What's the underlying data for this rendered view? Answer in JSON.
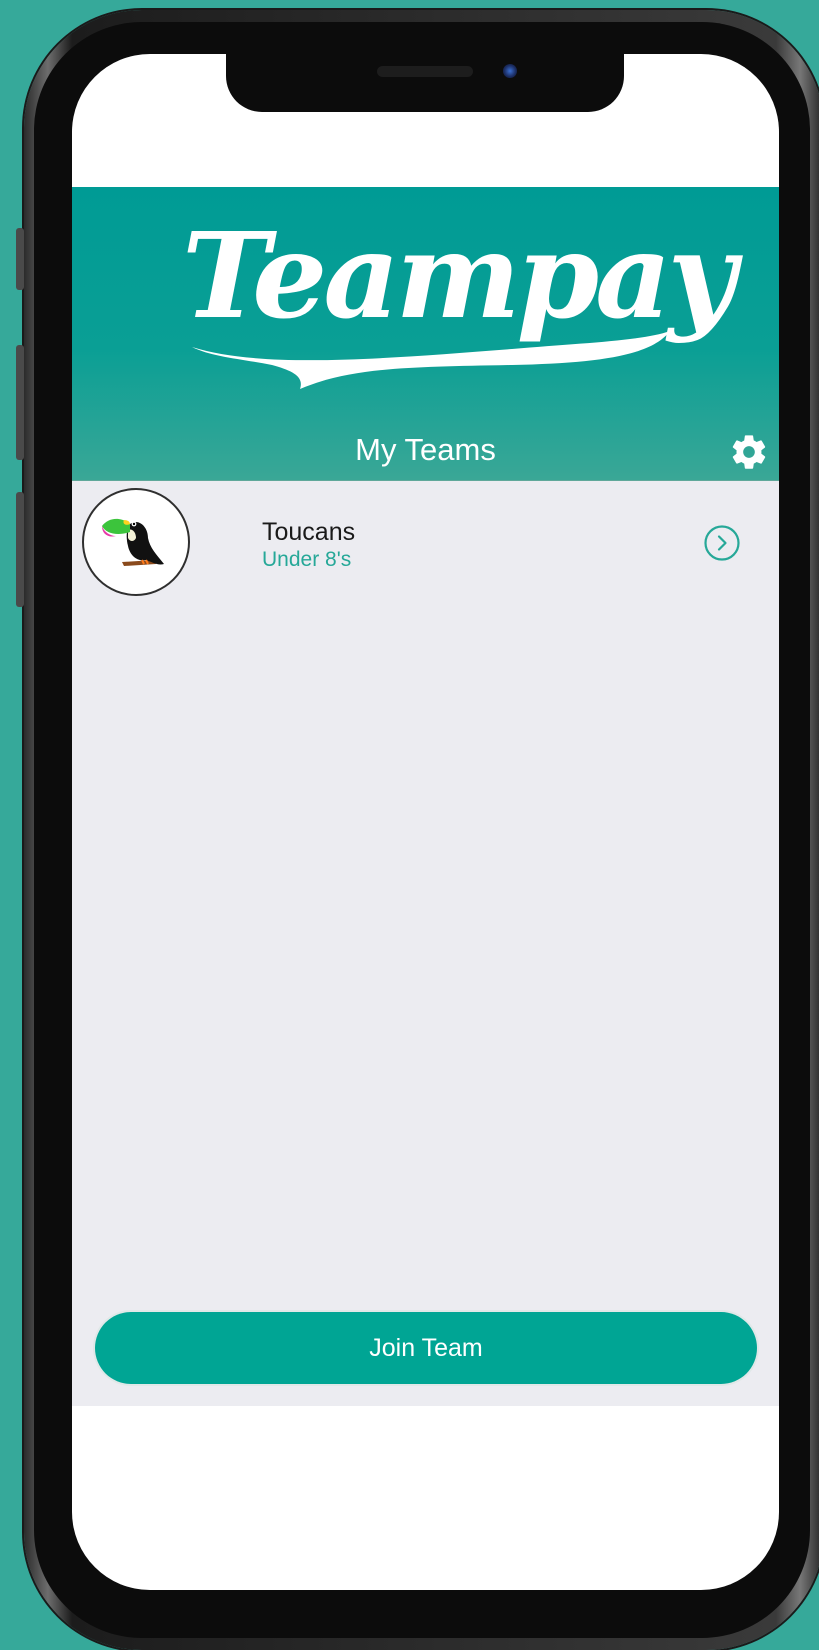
{
  "app": {
    "logo_text": "Teampay",
    "title": "My Teams",
    "settings_icon": "gear-icon",
    "accent_color": "#00a594",
    "header_color": "#009b95"
  },
  "teams": [
    {
      "name": "Toucans",
      "subtitle": "Under 8's",
      "avatar_icon": "toucan-logo",
      "action_icon": "chevron-right-circle-icon"
    }
  ],
  "footer": {
    "join_label": "Join Team"
  }
}
